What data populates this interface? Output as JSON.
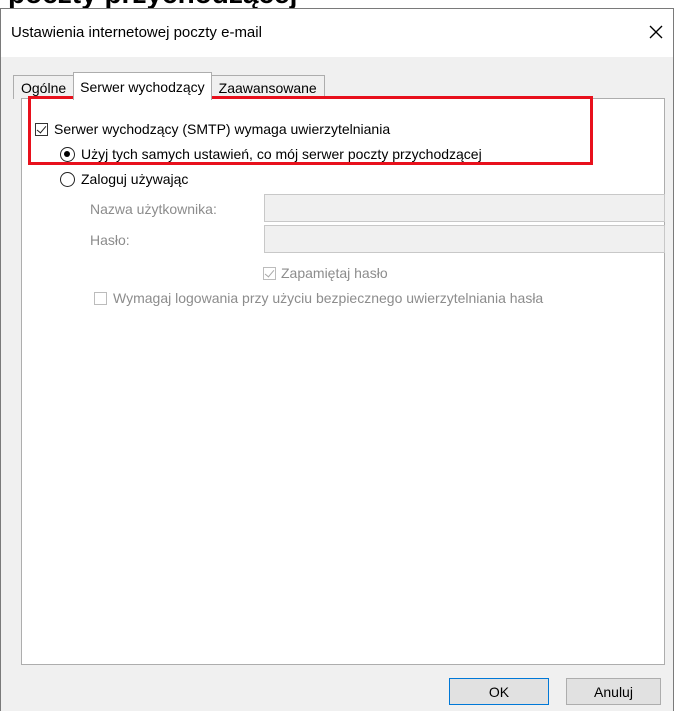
{
  "background_heading": {
    "text": "poczty przychodzącej"
  },
  "dialog": {
    "title": "Ustawienia internetowej poczty e-mail",
    "close_icon": "close-icon"
  },
  "tabs": [
    {
      "label": "Ogólne",
      "active": false
    },
    {
      "label": "Serwer wychodzący",
      "active": true
    },
    {
      "label": "Zaawansowane",
      "active": false
    }
  ],
  "outgoing": {
    "smtp_auth_label": "Serwer wychodzący (SMTP) wymaga uwierzytelniania",
    "smtp_auth_checked": true,
    "use_same_label": "Użyj tych samych ustawień, co mój serwer poczty przychodzącej",
    "use_same_selected": true,
    "login_using_label": "Zaloguj używając",
    "login_using_selected": false,
    "username_label": "Nazwa użytkownika:",
    "username_value": "",
    "password_label": "Hasło:",
    "password_value": "",
    "remember_password_label": "Zapamiętaj hasło",
    "remember_password_checked": true,
    "spa_label": "Wymagaj logowania przy użyciu bezpiecznego uwierzytelniania hasła",
    "spa_checked": false
  },
  "buttons": {
    "ok_label": "OK",
    "cancel_label": "Anuluj"
  },
  "colors": {
    "highlight_border": "#e8101c",
    "default_button_border": "#0078d7",
    "body_background": "#f0f0f0"
  }
}
